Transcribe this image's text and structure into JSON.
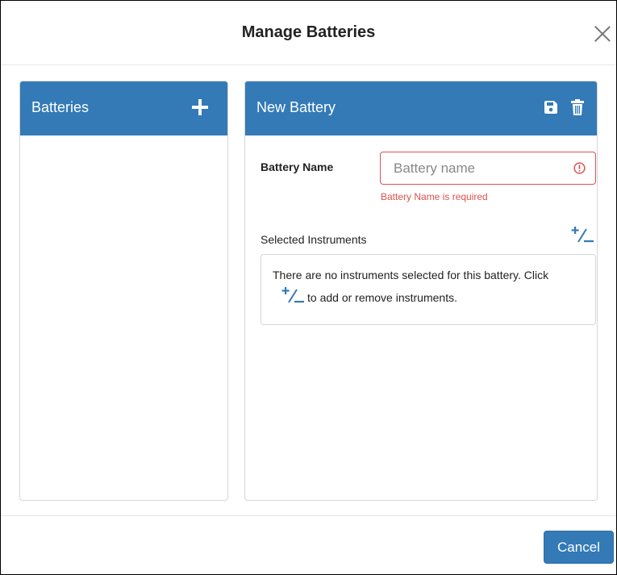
{
  "dialog": {
    "title": "Manage Batteries",
    "close_icon": "close-icon"
  },
  "batteries_panel": {
    "title": "Batteries",
    "add_icon": "plus-icon"
  },
  "editor_panel": {
    "title": "New Battery",
    "save_icon": "floppy-disk-icon",
    "delete_icon": "trash-icon",
    "name_label": "Battery Name",
    "name_value": "",
    "name_placeholder": "Battery name",
    "name_error": "Battery Name is required",
    "instruments_label": "Selected Instruments",
    "instruments_empty_line1": "There are no instruments selected for this battery. Click",
    "instruments_empty_line2": "to add or remove instruments.",
    "add_remove_icon": "plus-minus-icon"
  },
  "footer": {
    "cancel_label": "Cancel"
  },
  "colors": {
    "primary": "#337ab7",
    "error": "#d9534f"
  }
}
